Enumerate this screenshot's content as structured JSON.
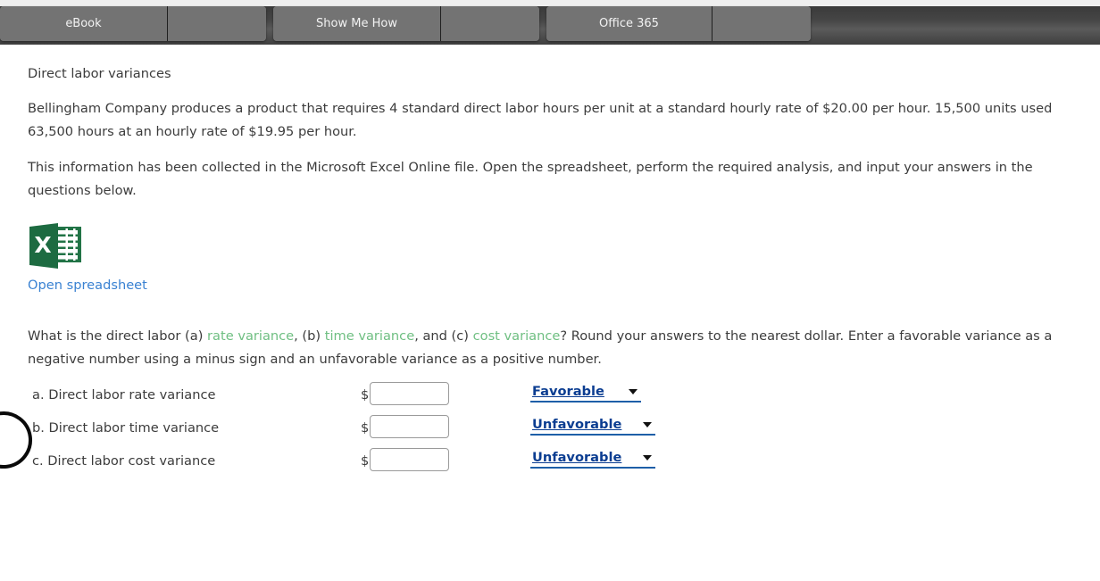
{
  "tabbar": {
    "tabs": [
      {
        "label": "eBook",
        "side_label": ""
      },
      {
        "label": "Show Me How",
        "side_label": ""
      },
      {
        "label": "Office 365",
        "side_label": ""
      }
    ]
  },
  "content": {
    "title": "Direct labor variances",
    "intro_paragraph": "Bellingham Company produces a product that requires 4 standard direct labor hours per unit at a standard hourly rate of $20.00 per hour. 15,500 units used 63,500 hours at an hourly rate of $19.95 per hour.",
    "excel_paragraph": "This information has been collected in the Microsoft Excel Online file. Open the spreadsheet, perform the required analysis, and input your answers in the questions below.",
    "excel_icon_letter": "X",
    "open_spreadsheet_label": "Open spreadsheet",
    "question": {
      "part1": "What is the direct labor (a) ",
      "link_a": "rate variance",
      "part2": ", (b) ",
      "link_b": "time variance",
      "part3": ", and (c) ",
      "link_c": "cost variance",
      "part4": "? Round your answers to the nearest dollar. Enter a favorable variance as a negative number using a minus sign and an unfavorable variance as a positive number."
    }
  },
  "answers": {
    "dollar_sign": "$",
    "rows": [
      {
        "label": "a. Direct labor rate variance",
        "value": "",
        "placeholder": "",
        "variance": "Favorable"
      },
      {
        "label": "b. Direct labor time variance",
        "value": "",
        "placeholder": "",
        "variance": "Unfavorable"
      },
      {
        "label": "c. Direct labor cost variance",
        "value": "",
        "placeholder": "",
        "variance": "Unfavorable"
      }
    ],
    "variance_options": [
      "Favorable",
      "Unfavorable"
    ]
  },
  "colors": {
    "link_blue": "#3a82d2",
    "link_green": "#6fbf82",
    "select_blue": "#0b3d91",
    "excel_green": "#217346",
    "tab_gray": "#737373",
    "body_text": "#3c3c3c"
  }
}
